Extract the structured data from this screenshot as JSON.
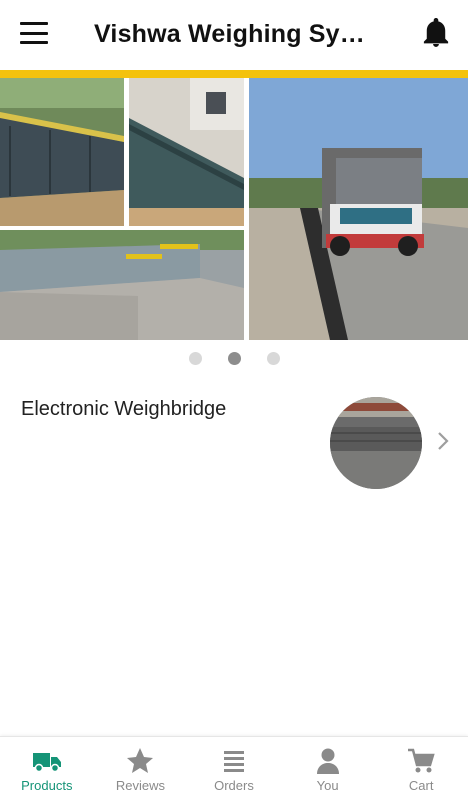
{
  "app_bar": {
    "title": "Vishwa Weighing Syst…",
    "menu_icon": "hamburger-menu-icon",
    "notification_icon": "bell-icon",
    "accent_color": "#f4c20d"
  },
  "banner": {
    "slide_count": 3,
    "active_slide": 2
  },
  "products": [
    {
      "name": "Electronic Weighbridge",
      "thumbnail": "weighbridge-image",
      "chevron_icon": "chevron-right-icon"
    }
  ],
  "bottom_nav": {
    "active_color": "#159477",
    "inactive_color": "#8a8a8a",
    "items": [
      {
        "label": "Products",
        "icon": "truck-icon",
        "active": true
      },
      {
        "label": "Reviews",
        "icon": "star-icon",
        "active": false
      },
      {
        "label": "Orders",
        "icon": "list-icon",
        "active": false
      },
      {
        "label": "You",
        "icon": "person-icon",
        "active": false
      },
      {
        "label": "Cart",
        "icon": "cart-icon",
        "active": false
      }
    ]
  }
}
